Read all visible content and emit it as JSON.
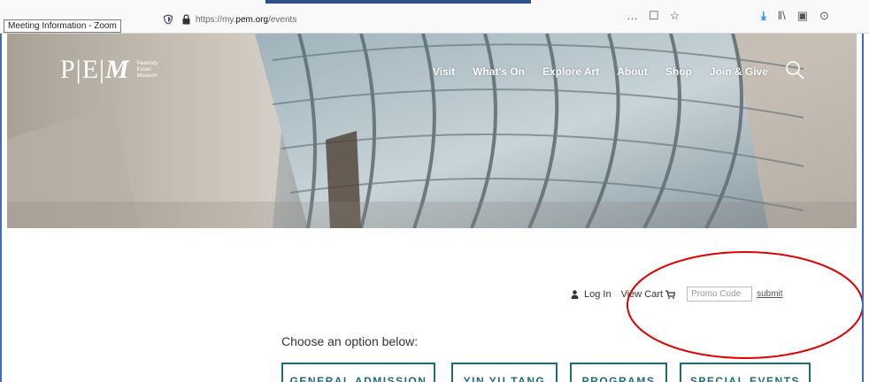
{
  "browser": {
    "tooltip": "Meeting Information - Zoom",
    "url_prefix": "https://my.",
    "url_domain": "pem.org",
    "url_path": "/events",
    "more_icon": "…",
    "pocket_icon": "☐",
    "star_icon": "☆",
    "download_icon": "⤓",
    "library_icon": "‖\\",
    "sidebar_icon": "▣",
    "account_icon": "⊙"
  },
  "header": {
    "logo": {
      "mark_pe": "P|E|",
      "mark_m": "M",
      "sub_line1": "Peabody",
      "sub_line2": "Essex",
      "sub_line3": "Museum"
    },
    "nav": [
      "Visit",
      "What's On",
      "Explore Art",
      "About",
      "Shop",
      "Join & Give"
    ]
  },
  "utility": {
    "login": "Log In",
    "view_cart": "View Cart",
    "promo_placeholder": "Promo Code",
    "submit": "submit"
  },
  "main": {
    "choose_label": "Choose an option below:",
    "options": [
      "GENERAL ADMISSION",
      "YIN YU TANG",
      "PROGRAMS",
      "SPECIAL EVENTS"
    ]
  },
  "colors": {
    "accent_teal": "#1f6b75",
    "annotation_red": "#e00000",
    "frame_blue": "#3b6cc4"
  }
}
